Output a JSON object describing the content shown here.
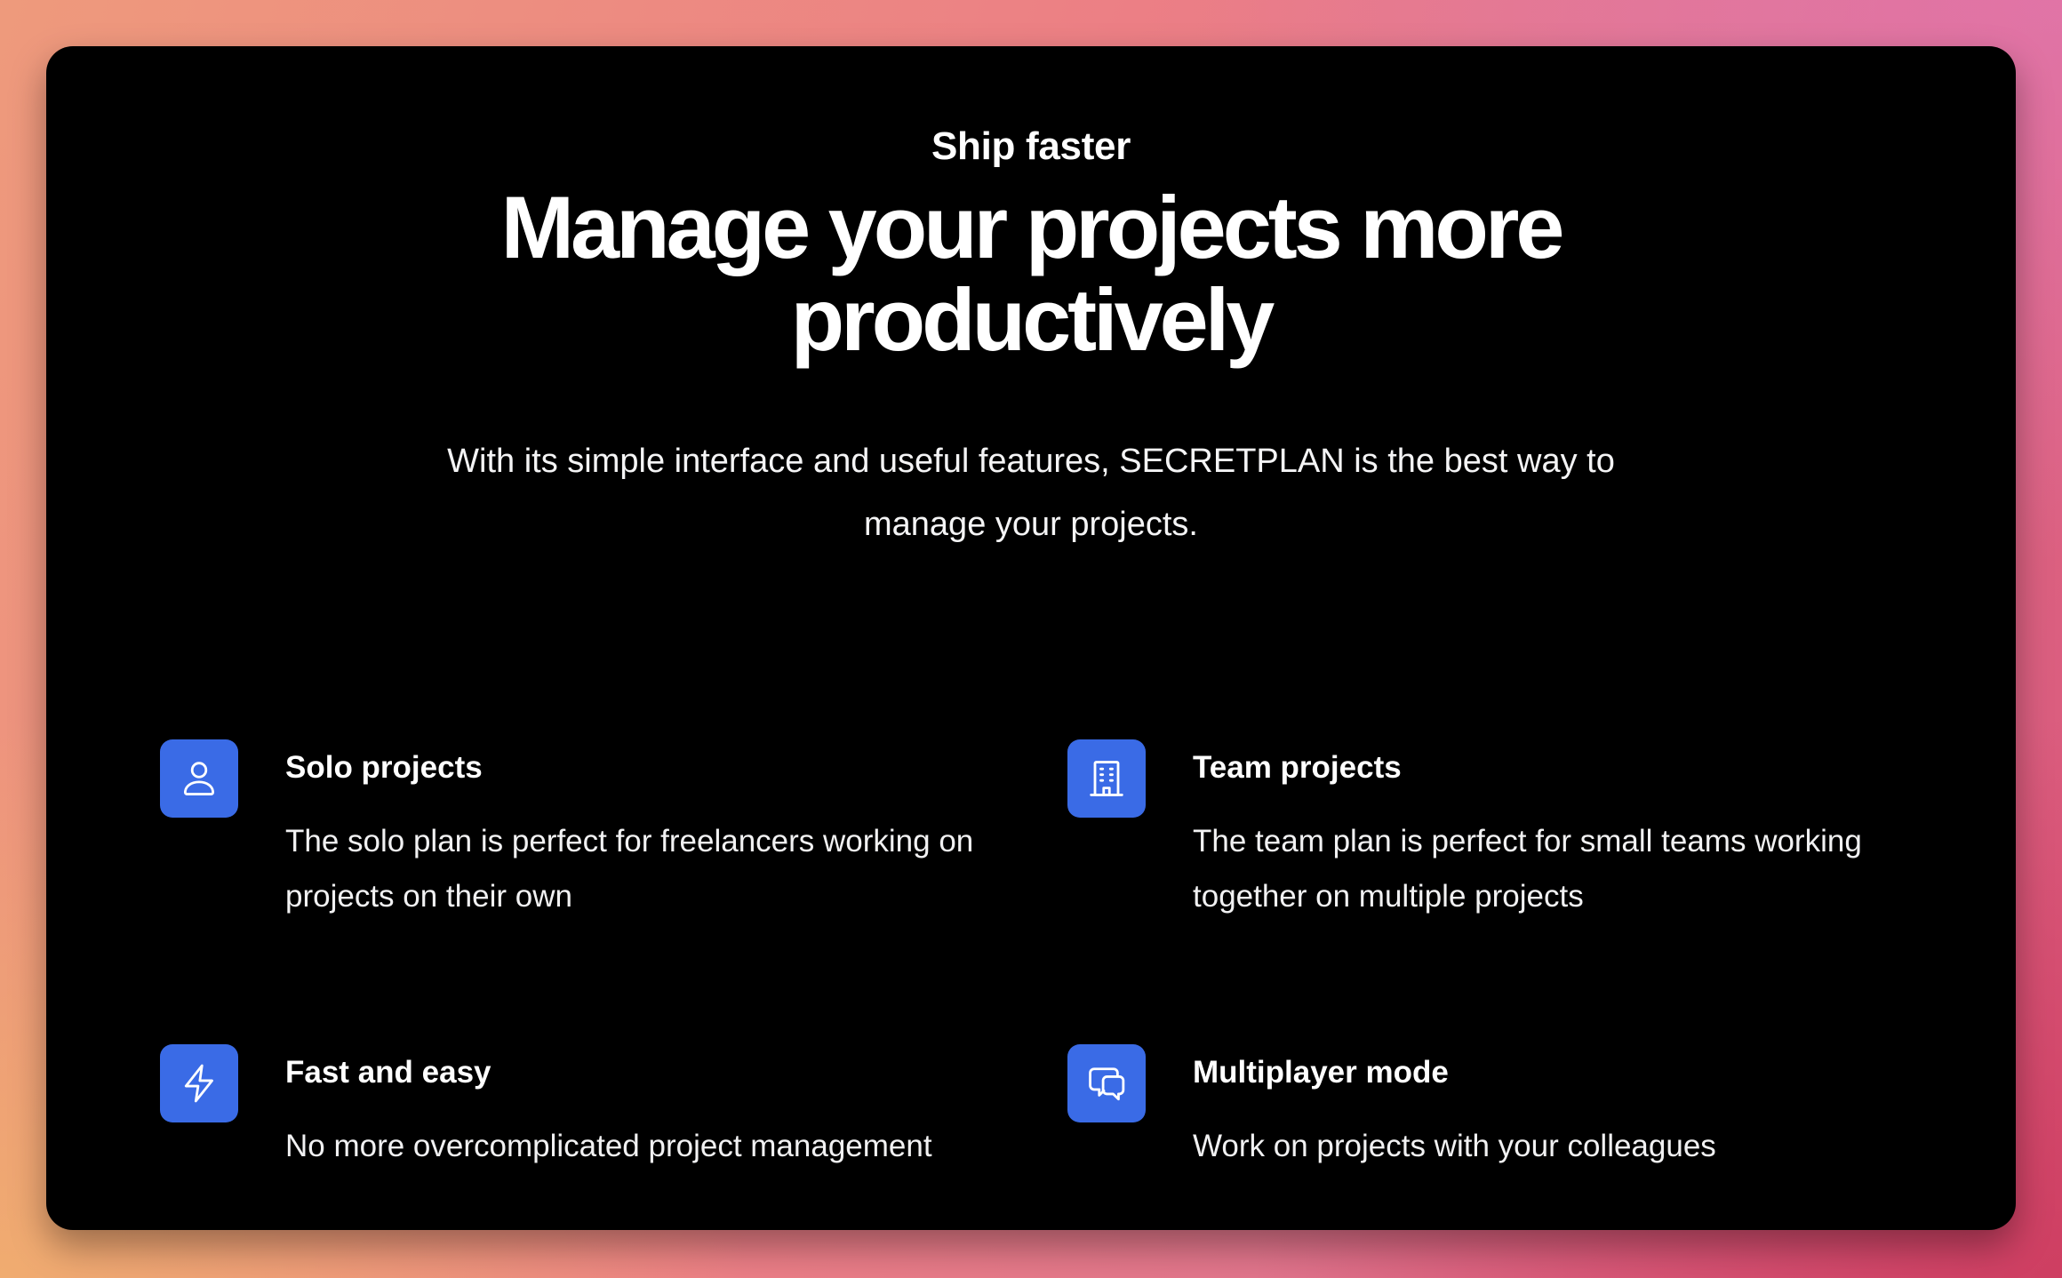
{
  "section": {
    "eyebrow": "Ship faster",
    "headline": "Manage your projects more productively",
    "subtitle": "With its simple interface and useful features, SECRETPLAN is the best way to manage your projects."
  },
  "features": [
    {
      "icon": "user-icon",
      "title": "Solo projects",
      "description": "The solo plan is perfect for freelancers working on projects on their own"
    },
    {
      "icon": "building-icon",
      "title": "Team projects",
      "description": "The team plan is perfect for small teams working together on multiple projects"
    },
    {
      "icon": "lightning-bolt-icon",
      "title": "Fast and easy",
      "description": "No more overcomplicated project management"
    },
    {
      "icon": "chat-bubbles-icon",
      "title": "Multiplayer mode",
      "description": "Work on projects with your colleagues"
    }
  ],
  "colors": {
    "card_background": "#000000",
    "icon_background": "#3a6be6",
    "text": "#ffffff"
  }
}
